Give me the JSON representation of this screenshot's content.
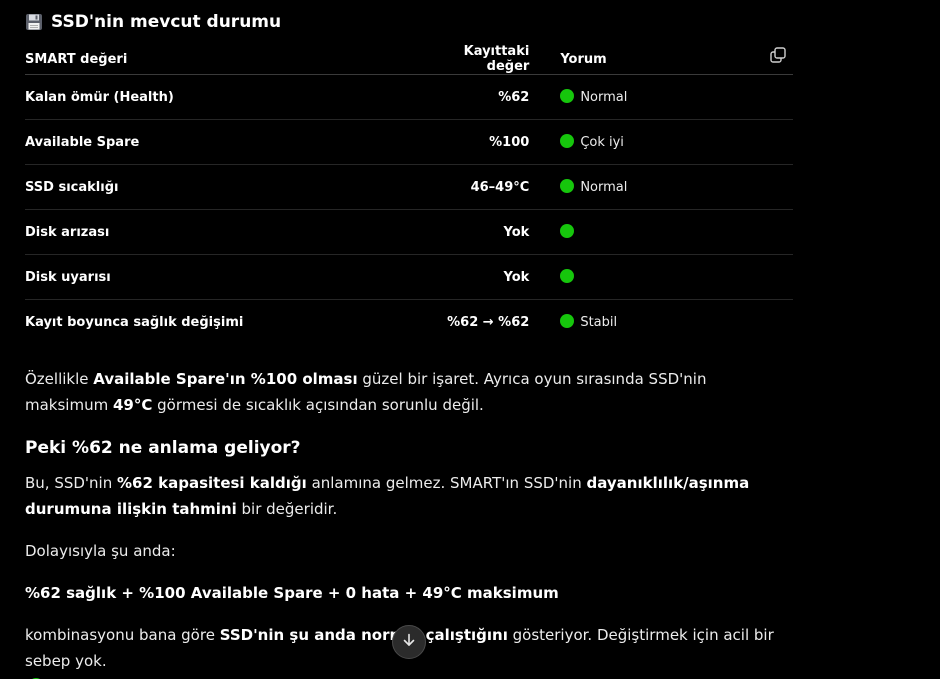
{
  "heading": {
    "icon": "floppy-disk-icon",
    "title": "SSD'nin mevcut durumu"
  },
  "table": {
    "headers": [
      "SMART değeri",
      "Kayıttaki değer",
      "Yorum"
    ],
    "copy_icon": "copy-icon",
    "rows": [
      {
        "attr": "Kalan ömür (Health)",
        "value": "%62",
        "comment": "Normal"
      },
      {
        "attr": "Available Spare",
        "value": "%100",
        "comment": "Çok iyi"
      },
      {
        "attr": "SSD sıcaklığı",
        "value": "46–49°C",
        "comment": "Normal"
      },
      {
        "attr": "Disk arızası",
        "value": "Yok",
        "comment": ""
      },
      {
        "attr": "Disk uyarısı",
        "value": "Yok",
        "comment": ""
      },
      {
        "attr": "Kayıt boyunca sağlık değişimi",
        "value": "%62 → %62",
        "comment": "Stabil"
      }
    ],
    "status_color": "#16c60c"
  },
  "para1": {
    "t1": "Özellikle ",
    "b1": "Available Spare'ın %100 olması",
    "t2": " güzel bir işaret. Ayrıca oyun sırasında SSD'nin maksimum ",
    "b2": "49°C",
    "t3": " görmesi de sıcaklık açısından sorunlu değil."
  },
  "subheading": "Peki %62 ne anlama geliyor?",
  "para2": {
    "t1": "Bu, SSD'nin ",
    "b1": "%62 kapasitesi kaldığı",
    "t2": " anlamına gelmez. SMART'ın SSD'nin ",
    "b2": "dayanıklılık/aşınma durumuna ilişkin tahmini",
    "t3": " bir değeridir."
  },
  "para3": "Dolayısıyla şu anda:",
  "para4": "%62 sağlık + %100 Available Spare + 0 hata + 49°C maksimum",
  "para5": {
    "t1": "kombinasyonu bana göre ",
    "b1": "SSD'nin şu anda normal çalıştığını",
    "t2": " gösteriyor. Değiştirmek için acil bir sebep yok."
  },
  "scroll_button_icon": "arrow-down-icon"
}
